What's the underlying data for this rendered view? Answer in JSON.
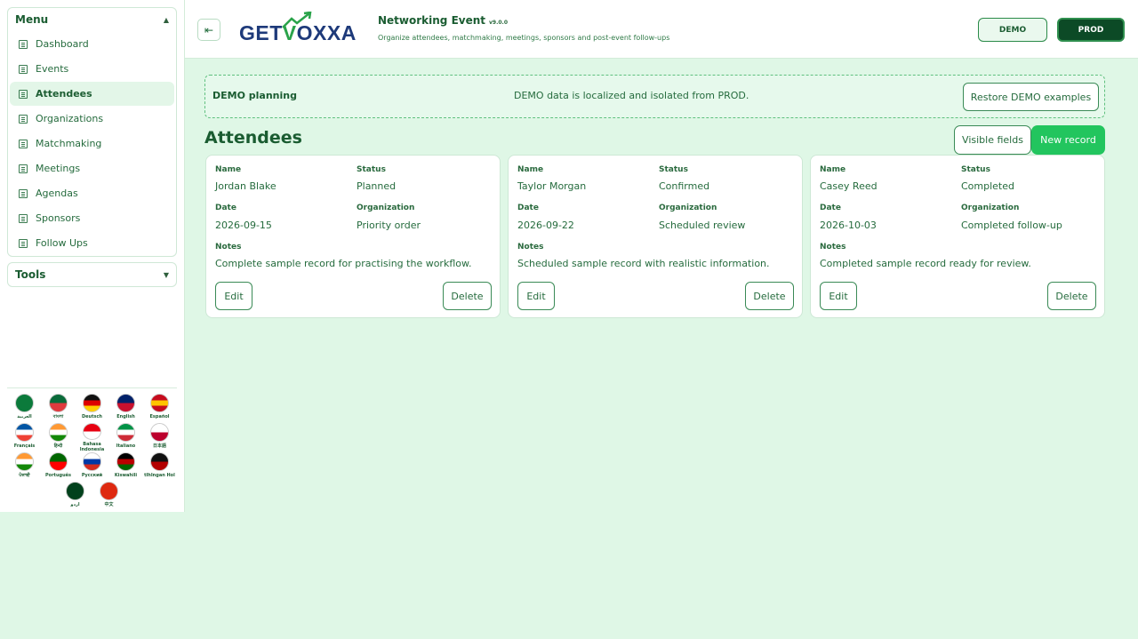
{
  "sidebar": {
    "menu_title": "Menu",
    "tools_title": "Tools",
    "items": [
      {
        "label": "Dashboard"
      },
      {
        "label": "Events"
      },
      {
        "label": "Attendees"
      },
      {
        "label": "Organizations"
      },
      {
        "label": "Matchmaking"
      },
      {
        "label": "Meetings"
      },
      {
        "label": "Agendas"
      },
      {
        "label": "Sponsors"
      },
      {
        "label": "Follow Ups"
      }
    ],
    "languages": [
      {
        "label": "العربية",
        "colors": [
          "#0b7a3b",
          "#0b7a3b"
        ]
      },
      {
        "label": "বাংলা",
        "colors": [
          "#0a6b3a",
          "#e03a3e"
        ]
      },
      {
        "label": "Deutsch",
        "colors": [
          "#111111",
          "#dd0000",
          "#ffce00"
        ]
      },
      {
        "label": "English",
        "colors": [
          "#012169",
          "#c8102e"
        ]
      },
      {
        "label": "Español",
        "colors": [
          "#c60b1e",
          "#ffc400",
          "#c60b1e"
        ]
      },
      {
        "label": "Français",
        "colors": [
          "#0055a4",
          "#ffffff",
          "#ef4135"
        ]
      },
      {
        "label": "हिन्दी",
        "colors": [
          "#ff9933",
          "#ffffff",
          "#138808"
        ]
      },
      {
        "label": "Bahasa Indonesia",
        "colors": [
          "#e70011",
          "#ffffff"
        ]
      },
      {
        "label": "Italiano",
        "colors": [
          "#009246",
          "#ffffff",
          "#ce2b37"
        ]
      },
      {
        "label": "日本語",
        "colors": [
          "#ffffff",
          "#bc002d"
        ]
      },
      {
        "label": "ਪੰਜਾਬੀ",
        "colors": [
          "#ff9933",
          "#ffffff",
          "#138808"
        ]
      },
      {
        "label": "Português",
        "colors": [
          "#006600",
          "#ff0000"
        ]
      },
      {
        "label": "Русский",
        "colors": [
          "#ffffff",
          "#0039a6",
          "#d52b1e"
        ]
      },
      {
        "label": "Kiswahili",
        "colors": [
          "#000000",
          "#bb0000",
          "#006600"
        ]
      },
      {
        "label": "tlhIngan Hol",
        "colors": [
          "#111111",
          "#b30000"
        ]
      },
      {
        "label": "اردو",
        "colors": [
          "#01411c",
          "#01411c"
        ]
      },
      {
        "label": "中文",
        "colors": [
          "#de2910",
          "#de2910"
        ]
      }
    ]
  },
  "header": {
    "logo_prefix": "GET",
    "logo_v": "V",
    "logo_suffix": "OXXA",
    "title": "Networking Event",
    "version": "v9.0.0",
    "subtitle": "Organize attendees, matchmaking, meetings, sponsors and post-event follow-ups",
    "demo_label": "DEMO",
    "prod_label": "PROD"
  },
  "notice": {
    "label": "DEMO planning",
    "text": "DEMO data is localized and isolated from PROD.",
    "restore_label": "Restore DEMO examples"
  },
  "main": {
    "title": "Attendees",
    "visible_fields_label": "Visible fields",
    "new_record_label": "New record",
    "field_labels": {
      "name": "Name",
      "status": "Status",
      "date": "Date",
      "organization": "Organization",
      "notes": "Notes"
    },
    "edit_label": "Edit",
    "delete_label": "Delete",
    "cards": [
      {
        "name": "Jordan Blake",
        "status": "Planned",
        "date": "2026-09-15",
        "organization": "Priority order",
        "notes": "Complete sample record for practising the workflow."
      },
      {
        "name": "Taylor Morgan",
        "status": "Confirmed",
        "date": "2026-09-22",
        "organization": "Scheduled review",
        "notes": "Scheduled sample record with realistic information."
      },
      {
        "name": "Casey Reed",
        "status": "Completed",
        "date": "2026-10-03",
        "organization": "Completed follow-up",
        "notes": "Completed sample record ready for review."
      }
    ]
  }
}
